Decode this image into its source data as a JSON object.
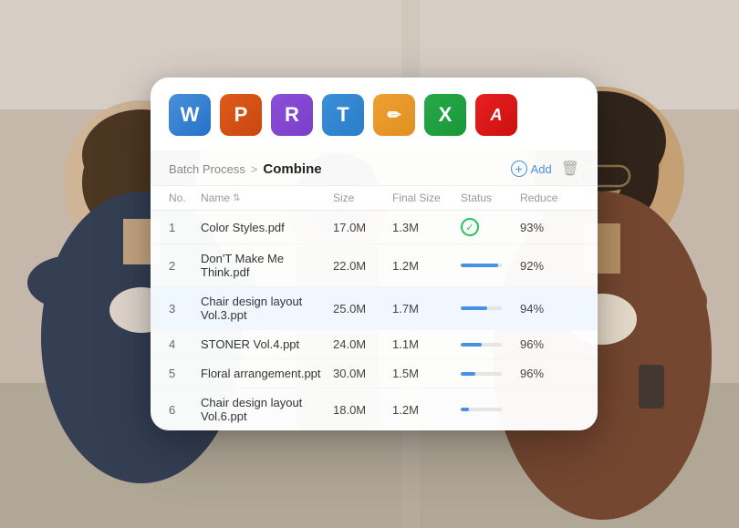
{
  "background": {
    "description": "Two people in a modern office setting"
  },
  "icons_bar": {
    "icons": [
      {
        "id": "word",
        "letter": "W",
        "css_class": "icon-w",
        "label": "Word icon"
      },
      {
        "id": "powerpoint",
        "letter": "P",
        "css_class": "icon-p",
        "label": "PowerPoint icon"
      },
      {
        "id": "rtf",
        "letter": "R",
        "css_class": "icon-r",
        "label": "RTF icon"
      },
      {
        "id": "text",
        "letter": "T",
        "css_class": "icon-t",
        "label": "Text icon"
      },
      {
        "id": "pages",
        "letter": "",
        "css_class": "icon-pages",
        "label": "Pages icon",
        "symbol": "✎"
      },
      {
        "id": "excel",
        "letter": "X",
        "css_class": "icon-x",
        "label": "Excel icon"
      },
      {
        "id": "acrobat",
        "letter": "",
        "css_class": "icon-acrobat",
        "label": "Acrobat icon",
        "symbol": "A"
      }
    ]
  },
  "breadcrumb": {
    "parent": "Batch Process",
    "separator": ">",
    "current": "Combine",
    "add_label": "Add",
    "add_icon": "⊕"
  },
  "table": {
    "headers": [
      {
        "key": "no",
        "label": "No."
      },
      {
        "key": "name",
        "label": "Name"
      },
      {
        "key": "size",
        "label": "Size"
      },
      {
        "key": "final_size",
        "label": "Final Size"
      },
      {
        "key": "status",
        "label": "Status"
      },
      {
        "key": "reduce",
        "label": "Reduce"
      }
    ],
    "rows": [
      {
        "no": 1,
        "name": "Color Styles.pdf",
        "size": "17.0M",
        "final_size": "1.3M",
        "status": "done",
        "progress": 100,
        "reduce": "93%"
      },
      {
        "no": 2,
        "name": "Don'T Make Me Think.pdf",
        "size": "22.0M",
        "final_size": "1.2M",
        "status": "progress",
        "progress": 90,
        "reduce": "92%"
      },
      {
        "no": 3,
        "name": "Chair design layout Vol.3.ppt",
        "size": "25.0M",
        "final_size": "1.7M",
        "status": "progress",
        "progress": 65,
        "reduce": "94%",
        "highlighted": true
      },
      {
        "no": 4,
        "name": "STONER Vol.4.ppt",
        "size": "24.0M",
        "final_size": "1.1M",
        "status": "progress",
        "progress": 50,
        "reduce": "96%"
      },
      {
        "no": 5,
        "name": "Floral arrangement.ppt",
        "size": "30.0M",
        "final_size": "1.5M",
        "status": "progress",
        "progress": 35,
        "reduce": "96%"
      },
      {
        "no": 6,
        "name": "Chair design layout Vol.6.ppt",
        "size": "18.0M",
        "final_size": "1.2M",
        "status": "progress",
        "progress": 20,
        "reduce": ""
      }
    ]
  }
}
